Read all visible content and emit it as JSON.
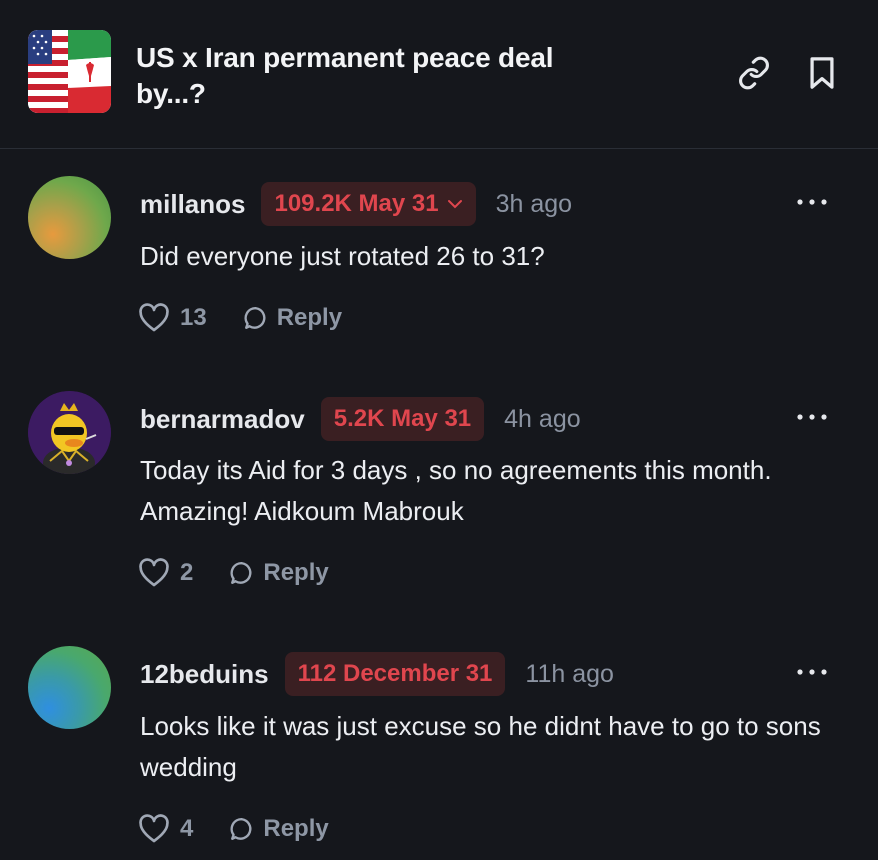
{
  "market": {
    "title": "US x Iran permanent peace deal by...?",
    "thumbnail_icon": "us-iran-flags-icon"
  },
  "header_actions": {
    "link_icon": "link-icon",
    "bookmark_icon": "bookmark-icon"
  },
  "comments": [
    {
      "username": "millanos",
      "position": "109.2K May 31",
      "position_has_dropdown": true,
      "time": "3h ago",
      "text": "Did everyone just rotated 26 to 31?",
      "likes": "13",
      "reply_label": "Reply",
      "avatar_icon": "gradient-avatar"
    },
    {
      "username": "bernarmadov",
      "position": "5.2K May 31",
      "position_has_dropdown": false,
      "time": "4h ago",
      "text": "Today its Aid for 3 days , so no agreements this month. Amazing! Aidkoum Mabrouk",
      "likes": "2",
      "reply_label": "Reply",
      "avatar_icon": "crowned-duck-avatar"
    },
    {
      "username": "12beduins",
      "position": "112 December 31",
      "position_has_dropdown": false,
      "time": "11h ago",
      "text": "Looks like it was just excuse so he didnt have to go to sons wedding",
      "likes": "4",
      "reply_label": "Reply",
      "avatar_icon": "gradient-avatar"
    }
  ],
  "colors": {
    "background": "#15171c",
    "position_text": "#e0464e",
    "position_bg": "#3a1f22",
    "muted": "#8b93a1"
  }
}
